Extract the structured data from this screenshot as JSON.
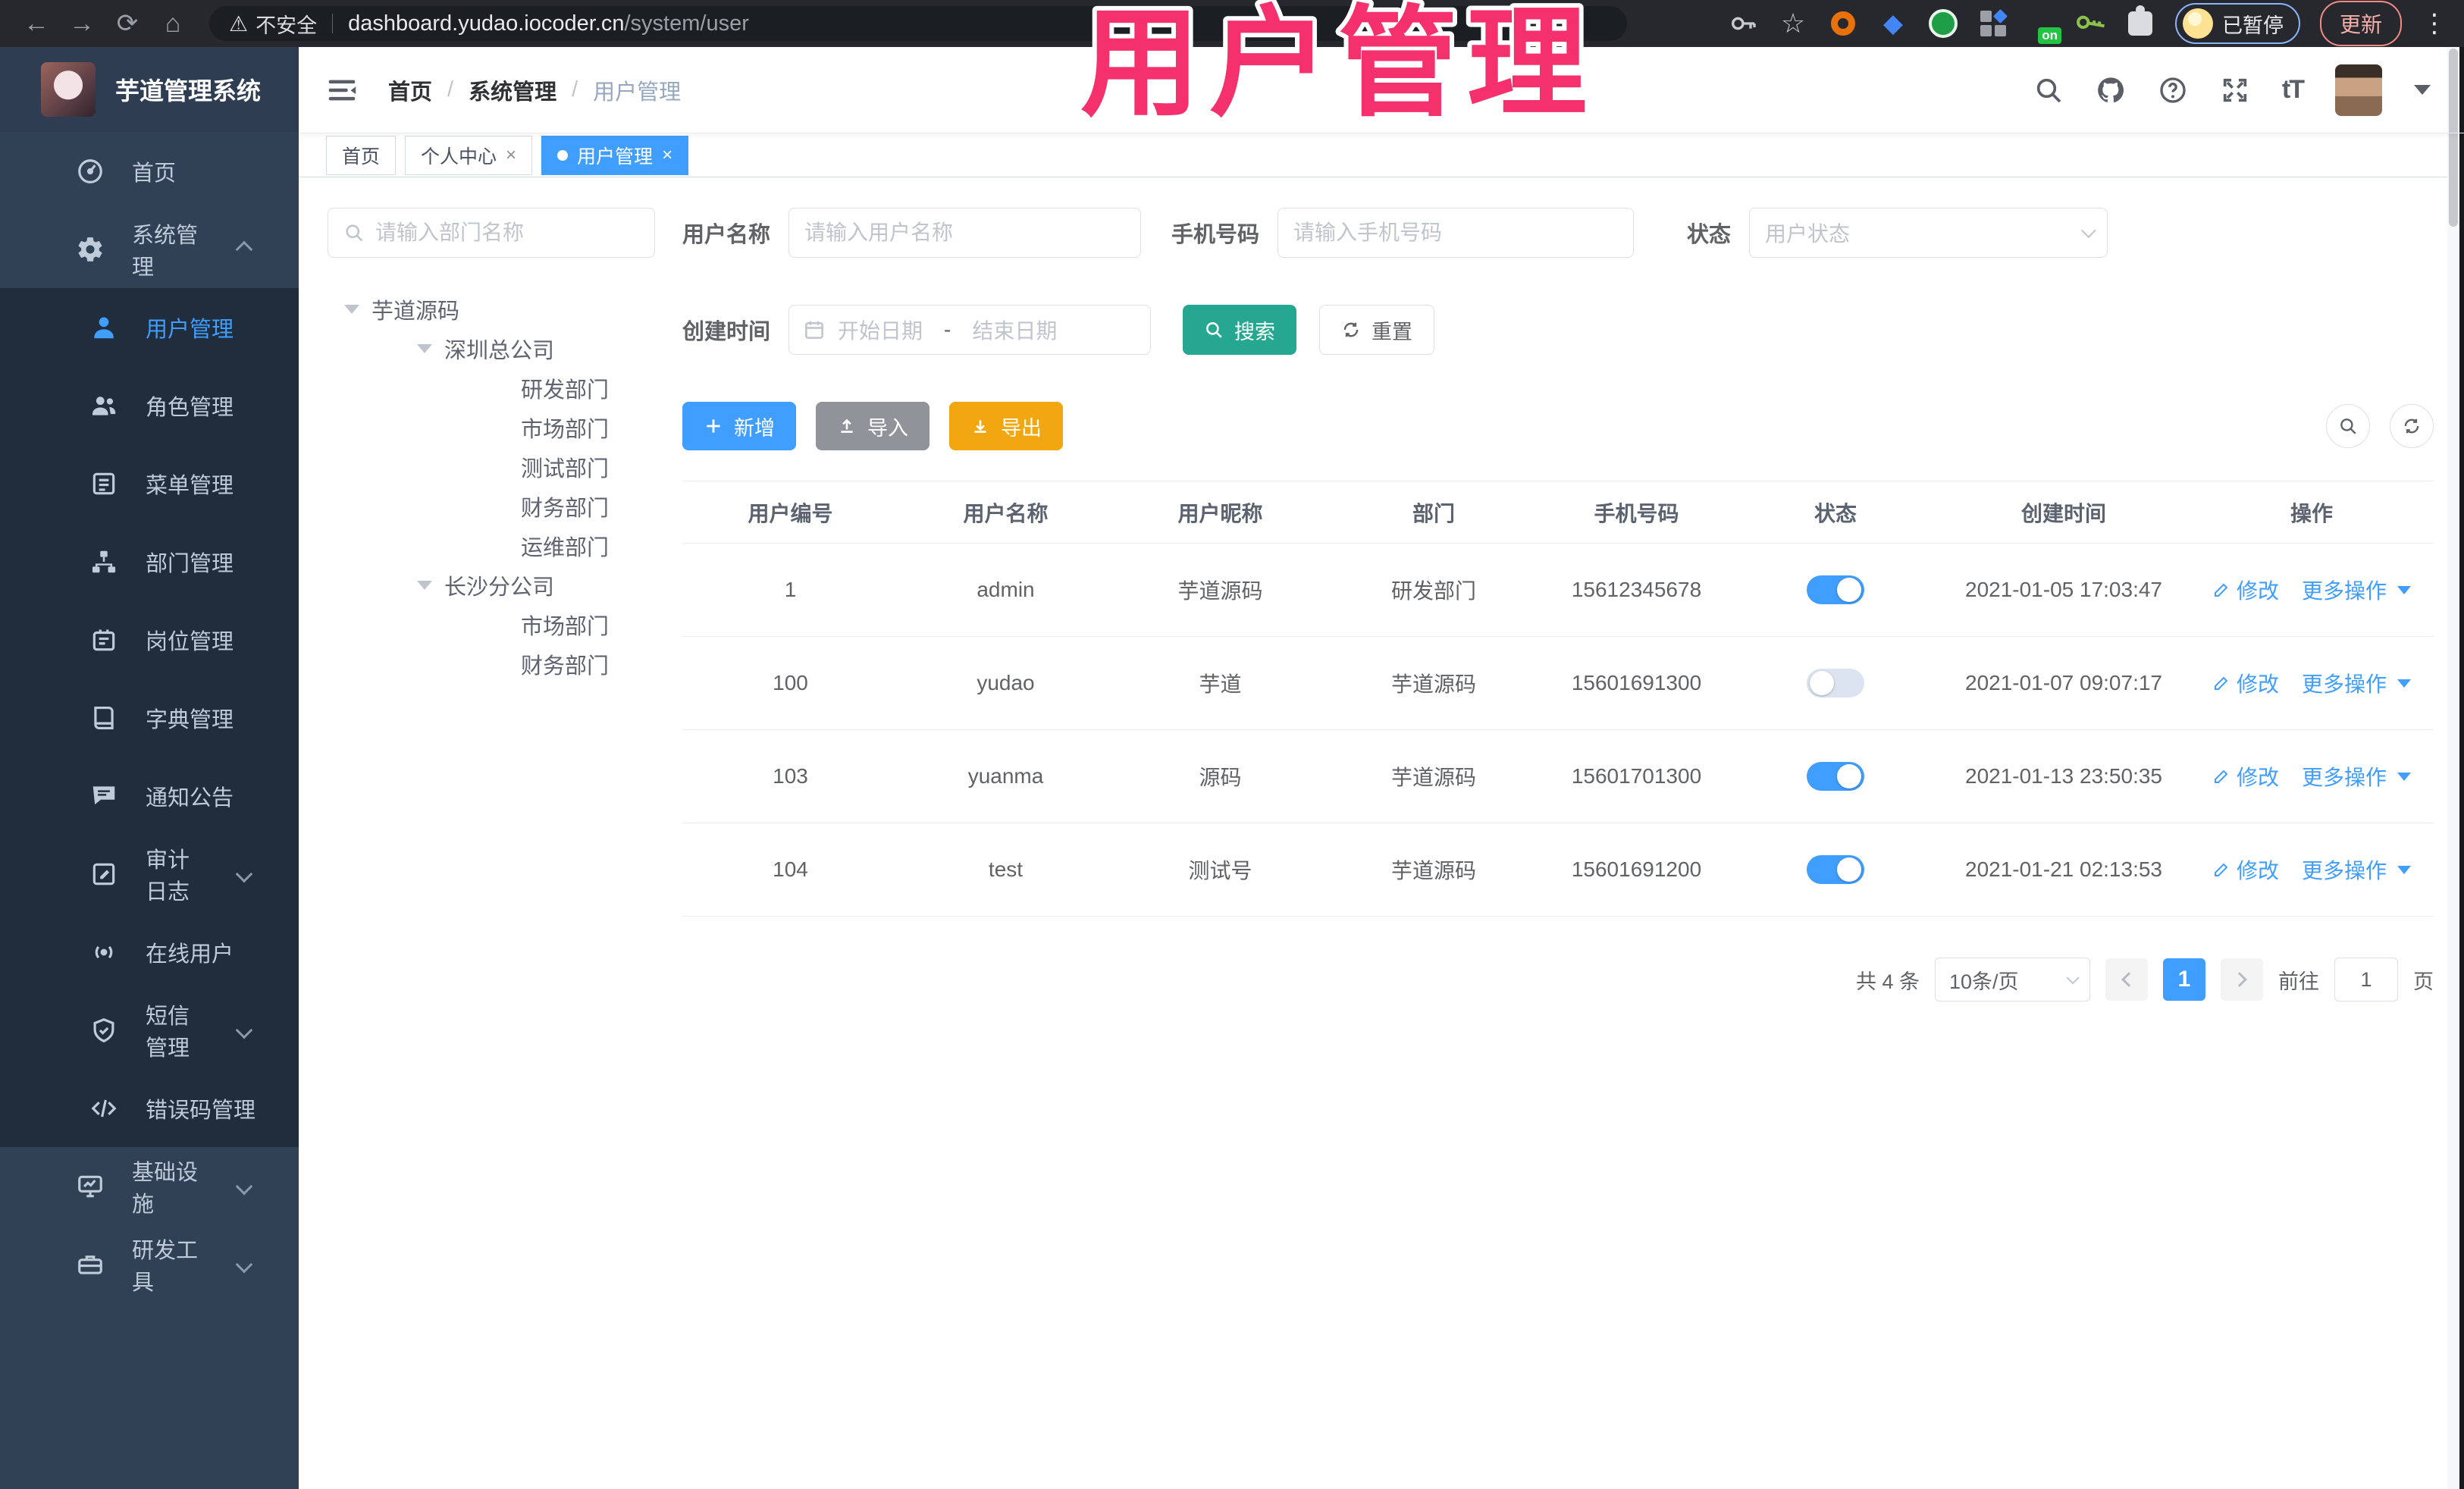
{
  "browser": {
    "not_secure_label": "不安全",
    "url_host": "dashboard.yudao.iocoder.cn",
    "url_path": "/system/user",
    "profile_status": "已暂停",
    "update_label": "更新",
    "extension_on_badge": "on"
  },
  "annotation": {
    "text": "用户管理",
    "color": "#f5316d"
  },
  "sidebar": {
    "title": "芋道管理系统",
    "menu_top": [
      {
        "label": "首页",
        "icon": "dashboard-icon"
      },
      {
        "label": "系统管理",
        "icon": "gear-icon",
        "state": "expanded"
      }
    ],
    "menu_system": [
      {
        "label": "用户管理",
        "icon": "user-icon",
        "active": true
      },
      {
        "label": "角色管理",
        "icon": "roles-icon"
      },
      {
        "label": "菜单管理",
        "icon": "menu-list-icon"
      },
      {
        "label": "部门管理",
        "icon": "org-tree-icon"
      },
      {
        "label": "岗位管理",
        "icon": "post-icon"
      },
      {
        "label": "字典管理",
        "icon": "dict-icon"
      },
      {
        "label": "通知公告",
        "icon": "announcement-icon"
      },
      {
        "label": "审计日志",
        "icon": "audit-log-icon",
        "collapsible": true
      },
      {
        "label": "在线用户",
        "icon": "online-user-icon"
      },
      {
        "label": "短信管理",
        "icon": "sms-icon",
        "collapsible": true
      },
      {
        "label": "错误码管理",
        "icon": "error-code-icon"
      }
    ],
    "menu_bottom": [
      {
        "label": "基础设施",
        "icon": "infrastructure-icon",
        "collapsible": true
      },
      {
        "label": "研发工具",
        "icon": "devtools-icon",
        "collapsible": true
      }
    ]
  },
  "navbar": {
    "breadcrumb": [
      "首页",
      "系统管理",
      "用户管理"
    ]
  },
  "tabs": [
    {
      "label": "首页",
      "closable": false,
      "active": false
    },
    {
      "label": "个人中心",
      "closable": true,
      "active": false
    },
    {
      "label": "用户管理",
      "closable": true,
      "active": true
    }
  ],
  "tree": {
    "search_placeholder": "请输入部门名称",
    "nodes": [
      {
        "label": "芋道源码"
      },
      {
        "label": "深圳总公司"
      },
      {
        "label": "研发部门"
      },
      {
        "label": "市场部门"
      },
      {
        "label": "测试部门"
      },
      {
        "label": "财务部门"
      },
      {
        "label": "运维部门"
      },
      {
        "label": "长沙分公司"
      },
      {
        "label": "市场部门"
      },
      {
        "label": "财务部门"
      }
    ]
  },
  "filters": {
    "username_label": "用户名称",
    "username_placeholder": "请输入用户名称",
    "mobile_label": "手机号码",
    "mobile_placeholder": "请输入手机号码",
    "status_label": "状态",
    "status_placeholder": "用户状态",
    "create_time_label": "创建时间",
    "date_start_placeholder": "开始日期",
    "date_separator": "-",
    "date_end_placeholder": "结束日期",
    "search_button": "搜索",
    "reset_button": "重置"
  },
  "toolbar": {
    "add_button": "新增",
    "import_button": "导入",
    "export_button": "导出"
  },
  "table": {
    "columns": [
      "用户编号",
      "用户名称",
      "用户昵称",
      "部门",
      "手机号码",
      "状态",
      "创建时间",
      "操作"
    ],
    "rows": [
      {
        "id": "1",
        "username": "admin",
        "nickname": "芋道源码",
        "dept": "研发部门",
        "mobile": "15612345678",
        "status": true,
        "created_at": "2021-01-05 17:03:47"
      },
      {
        "id": "100",
        "username": "yudao",
        "nickname": "芋道",
        "dept": "芋道源码",
        "mobile": "15601691300",
        "status": false,
        "created_at": "2021-01-07 09:07:17"
      },
      {
        "id": "103",
        "username": "yuanma",
        "nickname": "源码",
        "dept": "芋道源码",
        "mobile": "15601701300",
        "status": true,
        "created_at": "2021-01-13 23:50:35"
      },
      {
        "id": "104",
        "username": "test",
        "nickname": "测试号",
        "dept": "芋道源码",
        "mobile": "15601691200",
        "status": true,
        "created_at": "2021-01-21 02:13:53"
      }
    ],
    "edit_action": "修改",
    "more_action": "更多操作"
  },
  "pagination": {
    "total": "共 4 条",
    "page_size": "10条/页",
    "current_page": "1",
    "goto_label": "前往",
    "goto_value": "1",
    "page_unit": "页"
  },
  "colors": {
    "accent": "#409eff",
    "search_teal": "#26a792",
    "export_amber": "#f2a60f",
    "import_gray": "#909399"
  }
}
